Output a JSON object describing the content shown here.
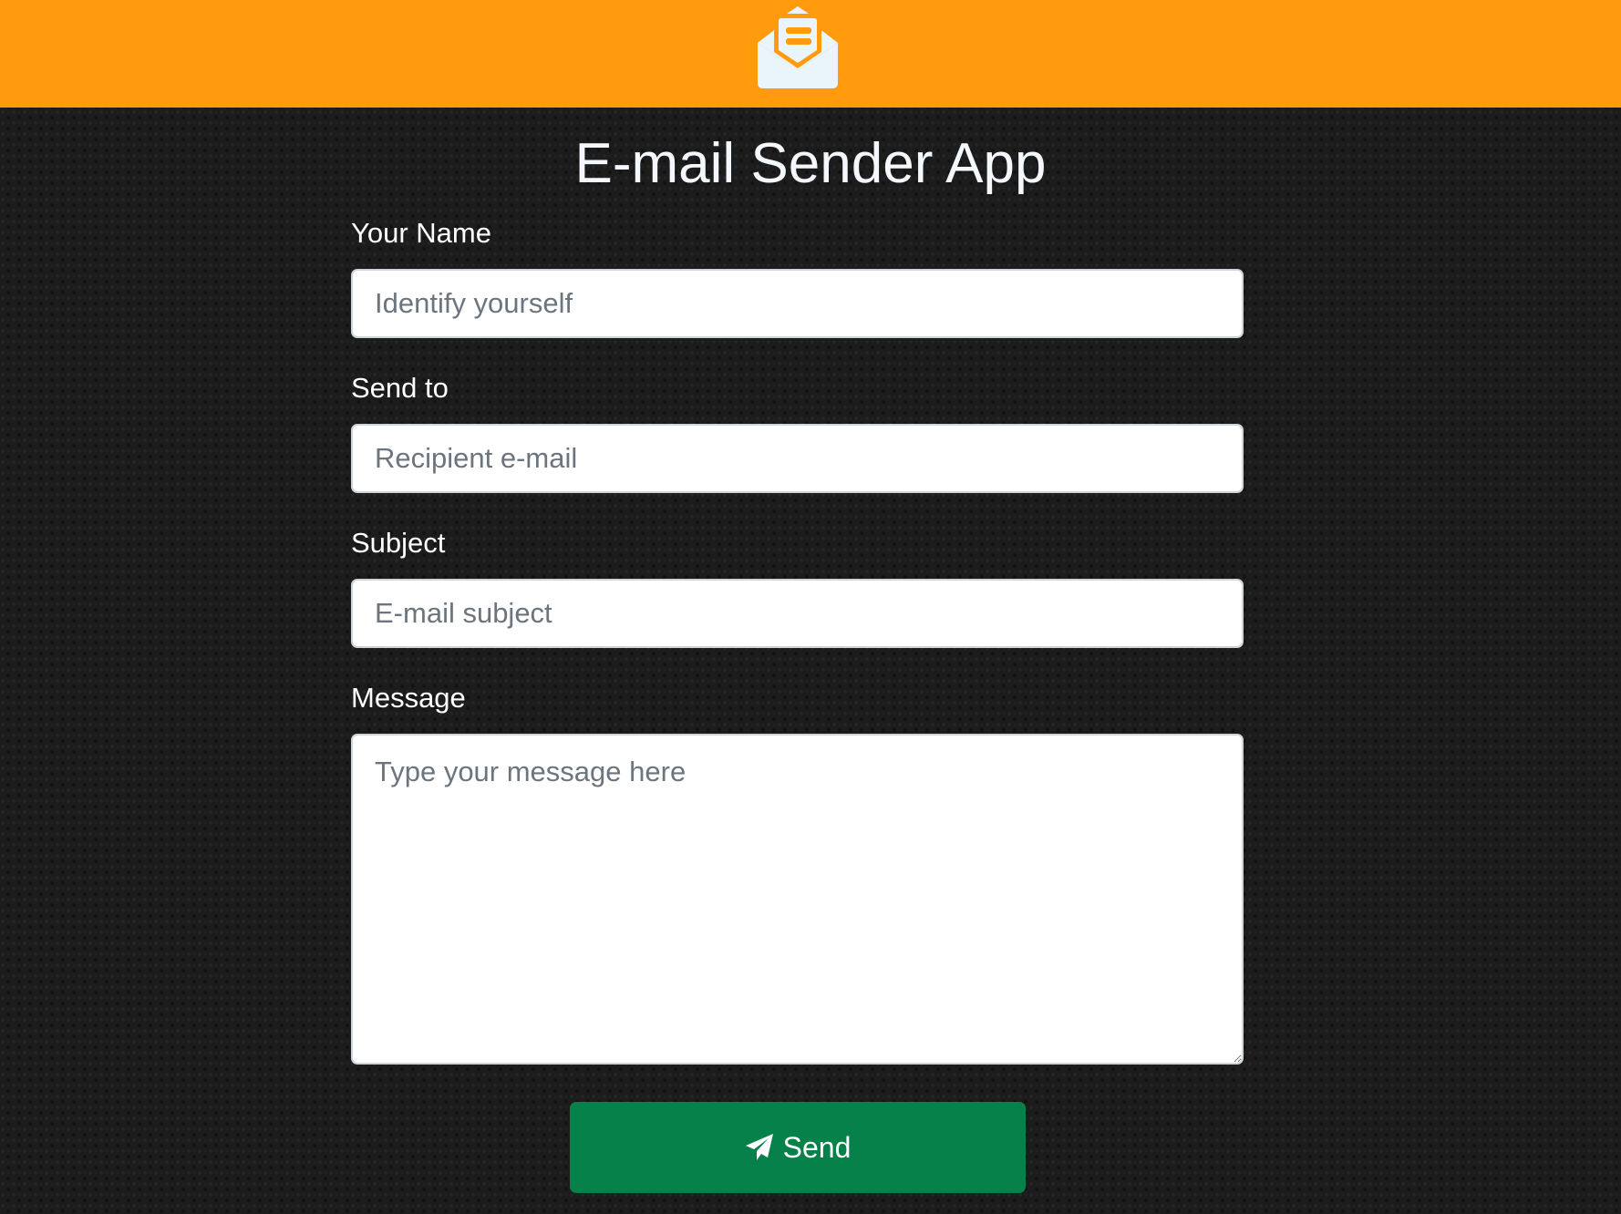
{
  "header": {
    "logo_icon": "envelope-open-text-icon",
    "background_color": "#ff9b0d"
  },
  "page": {
    "title": "E-mail Sender App"
  },
  "form": {
    "name": {
      "label": "Your Name",
      "placeholder": "Identify yourself",
      "value": ""
    },
    "to": {
      "label": "Send to",
      "placeholder": "Recipient e-mail",
      "value": ""
    },
    "subject": {
      "label": "Subject",
      "placeholder": "E-mail subject",
      "value": ""
    },
    "message": {
      "label": "Message",
      "placeholder": "Type your message here",
      "value": ""
    },
    "send": {
      "label": "Send",
      "icon": "paper-plane-icon",
      "color": "#07814a"
    }
  }
}
